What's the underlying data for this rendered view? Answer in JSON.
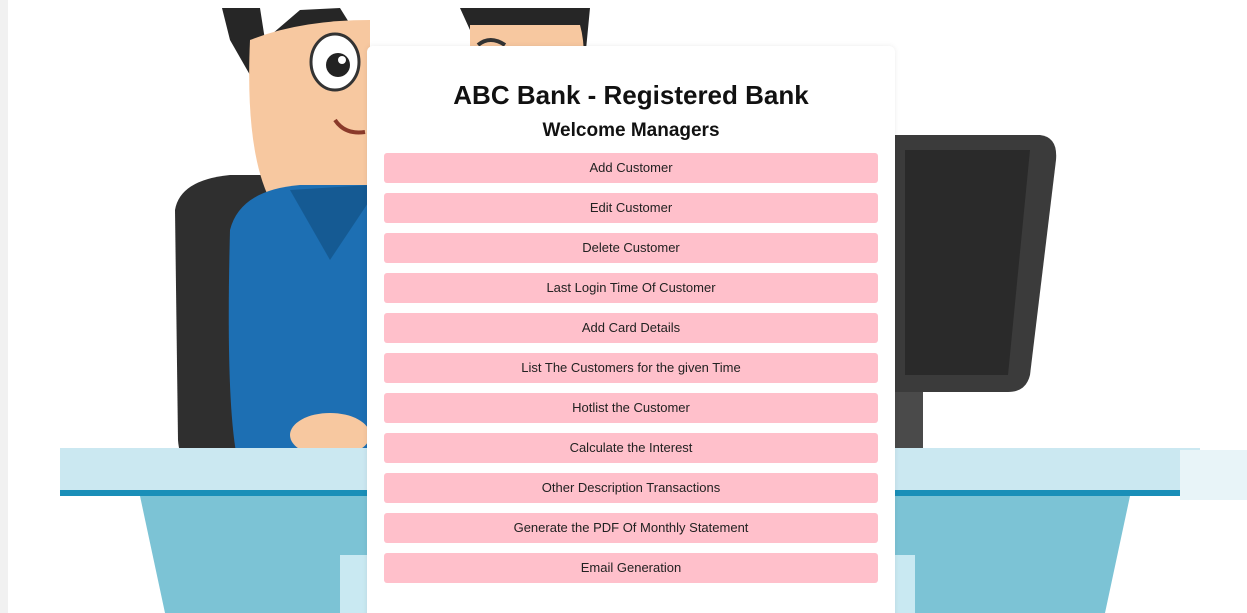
{
  "header": {
    "title": "ABC Bank - Registered Bank",
    "subtitle": "Welcome Managers"
  },
  "menu": {
    "items": [
      {
        "label": "Add Customer"
      },
      {
        "label": "Edit Customer"
      },
      {
        "label": "Delete Customer"
      },
      {
        "label": "Last Login Time Of Customer"
      },
      {
        "label": "Add Card Details"
      },
      {
        "label": "List The Customers for the given Time"
      },
      {
        "label": "Hotlist the Customer"
      },
      {
        "label": "Calculate the Interest"
      },
      {
        "label": "Other Description Transactions"
      },
      {
        "label": "Generate the PDF Of Monthly Statement"
      },
      {
        "label": "Email Generation"
      }
    ]
  },
  "colors": {
    "button_bg": "#ffc0cb",
    "card_bg": "#ffffff",
    "desk_top": "#a9dbe9",
    "desk_front": "#7cc3d5",
    "monitor": "#3b3b3b",
    "shirt": "#1d6fb3"
  },
  "background": {
    "illustration": "cartoon-man-at-desk-with-computer"
  }
}
